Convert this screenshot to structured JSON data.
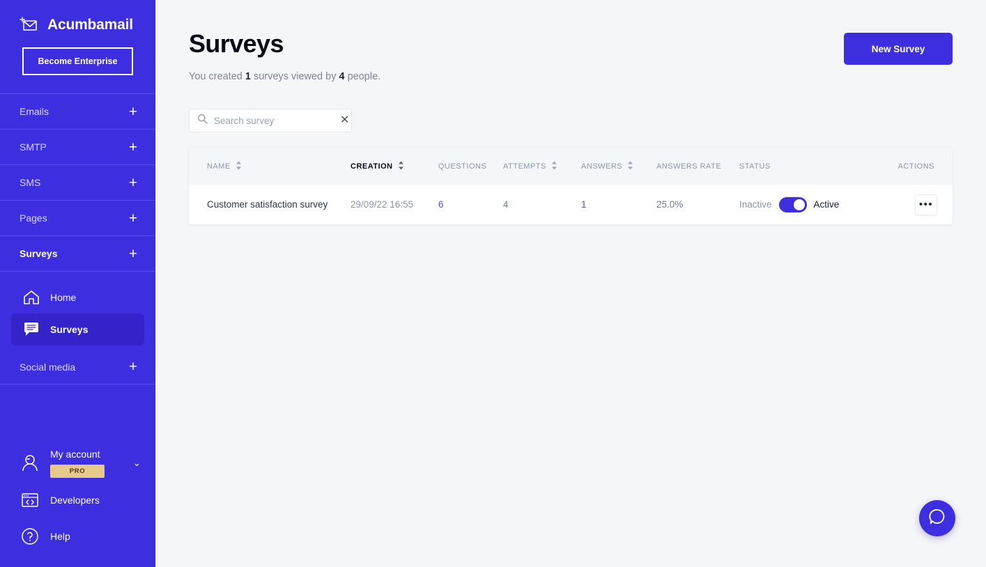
{
  "brand": {
    "name": "Acumbamail",
    "icon": "envelope-sparkle-icon"
  },
  "sidebar": {
    "enterprise_button": "Become Enterprise",
    "product_nav": [
      {
        "label": "Emails",
        "add": "+"
      },
      {
        "label": "SMTP",
        "add": "+"
      },
      {
        "label": "SMS",
        "add": "+"
      },
      {
        "label": "Pages",
        "add": "+"
      },
      {
        "label": "Surveys",
        "add": "+"
      }
    ],
    "section_nav": [
      {
        "label": "Home",
        "icon": "home-icon"
      },
      {
        "label": "Surveys",
        "icon": "speech-bubble-icon"
      }
    ],
    "social": {
      "label": "Social media",
      "add": "+"
    },
    "account": {
      "label": "My account",
      "badge": "PRO",
      "icon": "user-icon",
      "chevron": "⌄"
    },
    "developers": {
      "label": "Developers",
      "icon": "code-window-icon"
    },
    "help": {
      "label": "Help",
      "icon": "question-circle-icon"
    }
  },
  "header": {
    "title": "Surveys",
    "subtitle_pre": "You created ",
    "subtitle_count": "1",
    "subtitle_mid": " surveys viewed by ",
    "subtitle_people": "4",
    "subtitle_post": " people.",
    "new_survey_button": "New Survey"
  },
  "search": {
    "placeholder": "Search survey",
    "value": "",
    "clear": "✕"
  },
  "table": {
    "columns": [
      {
        "label": "NAME",
        "sortable": true,
        "sorted": false
      },
      {
        "label": "CREATION",
        "sortable": true,
        "sorted": true
      },
      {
        "label": "QUESTIONS",
        "sortable": false,
        "sorted": false
      },
      {
        "label": "ATTEMPTS",
        "sortable": true,
        "sorted": false
      },
      {
        "label": "ANSWERS",
        "sortable": true,
        "sorted": false
      },
      {
        "label": "ANSWERS RATE",
        "sortable": false,
        "sorted": false
      },
      {
        "label": "STATUS",
        "sortable": false,
        "sorted": false
      },
      {
        "label": "ACTIONS",
        "sortable": false,
        "sorted": false
      }
    ],
    "rows": [
      {
        "name": "Customer satisfaction survey",
        "creation": "29/09/22 16:55",
        "questions": "6",
        "attempts": "4",
        "answers": "1",
        "answers_rate": "25.0%",
        "status_off": "Inactive",
        "status_on": "Active",
        "status_active": true,
        "actions": "•••"
      }
    ]
  },
  "chat": {
    "icon": "chat-bubble-icon"
  },
  "colors": {
    "brand_purple": "#3d2fe0",
    "sidebar_active": "#3323c9",
    "link_purple": "#5b4bdd",
    "pro_badge": "#e9c88c",
    "page_bg": "#f5f6f7",
    "table_header_bg": "#f3f7fa"
  }
}
